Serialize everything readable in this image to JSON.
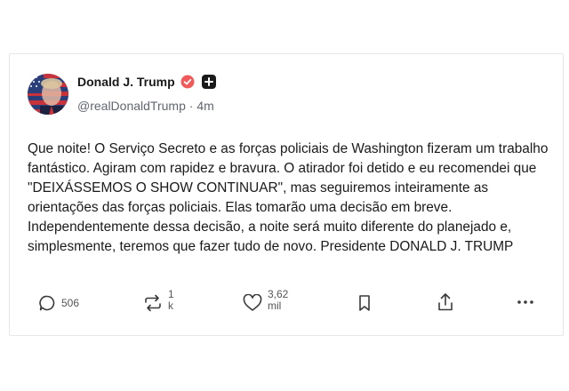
{
  "post": {
    "author": {
      "display_name": "Donald J. Trump",
      "handle": "@realDonaldTrump",
      "separator": "·",
      "time_ago": "4m",
      "verified_icon": "verified-badge-icon",
      "plus_icon": "plus-icon"
    },
    "text": "Que noite! O Serviço Secreto e as forças policiais de Washington fizeram um trabalho fantástico. Agiram com rapidez e bravura. O atirador foi detido e eu recomendei que \"DEIXÁSSEMOS O SHOW CONTINUAR\", mas seguiremos inteiramente as orientações das forças policiais. Elas tomarão uma decisão em breve. Independentemente dessa decisão, a noite será muito diferente do planejado e, simplesmente, teremos que fazer tudo de novo. Presidente DONALD J. TRUMP",
    "actions": {
      "replies": "506",
      "retruths_top": "1",
      "retruths_bottom": "k",
      "likes_top": "3,62",
      "likes_bottom": "mil"
    }
  },
  "colors": {
    "verified": "#f05a5a",
    "icon": "#3a3a3a",
    "muted": "#606770"
  }
}
